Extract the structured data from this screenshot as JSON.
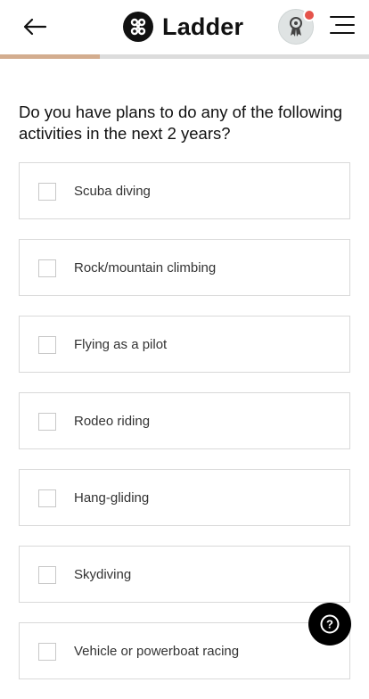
{
  "header": {
    "brand_name": "Ladder",
    "icons": {
      "back": "arrow-left-icon",
      "brand": "ladder-logo-icon",
      "avatar": "ribbon-award-icon",
      "menu": "hamburger-menu-icon"
    },
    "notification_color": "#e5534b"
  },
  "progress": {
    "value": 0.27,
    "fill_color": "#d3ad8f",
    "track_color": "#dcdcdc"
  },
  "question": "Do you have plans to do any of the following activities in the next 2 years?",
  "options": [
    {
      "label": "Scuba diving",
      "checked": false
    },
    {
      "label": "Rock/mountain climbing",
      "checked": false
    },
    {
      "label": "Flying as a pilot",
      "checked": false
    },
    {
      "label": "Rodeo riding",
      "checked": false
    },
    {
      "label": "Hang-gliding",
      "checked": false
    },
    {
      "label": "Skydiving",
      "checked": false
    },
    {
      "label": "Vehicle or powerboat racing",
      "checked": false
    }
  ],
  "help": {
    "symbol": "?",
    "icon": "help-question-icon"
  }
}
